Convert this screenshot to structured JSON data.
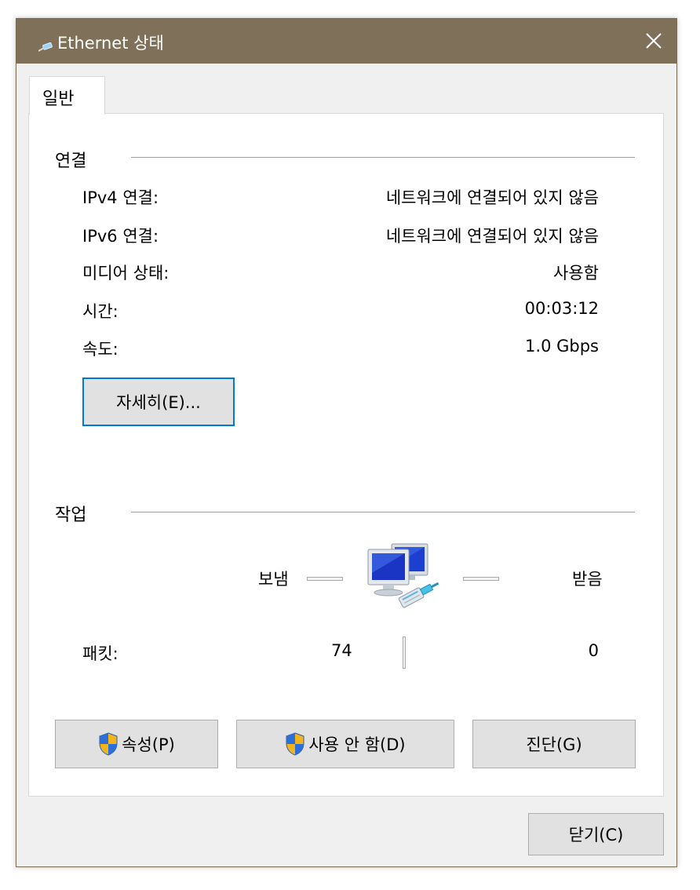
{
  "window": {
    "title": "Ethernet 상태",
    "icon": "network-cable-icon",
    "close": "close-icon"
  },
  "tabs": [
    {
      "label": "일반"
    }
  ],
  "connection": {
    "heading": "연결",
    "rows": [
      {
        "label": "IPv4 연결:",
        "value": "네트워크에 연결되어 있지 않음"
      },
      {
        "label": "IPv6 연결:",
        "value": "네트워크에 연결되어 있지 않음"
      },
      {
        "label": "미디어 상태:",
        "value": "사용함"
      },
      {
        "label": "시간:",
        "value": "00:03:12"
      },
      {
        "label": "속도:",
        "value": "1.0 Gbps"
      }
    ],
    "details_button": "자세히(E)..."
  },
  "activity": {
    "heading": "작업",
    "sent_label": "보냄",
    "received_label": "받음",
    "packets_label": "패킷:",
    "packets_sent": "74",
    "packets_received": "0",
    "icon": "network-computers-icon"
  },
  "actions": {
    "properties": "속성(P)",
    "disable": "사용 안 함(D)",
    "diagnose": "진단(G)",
    "close": "닫기(C)"
  },
  "colors": {
    "titlebar": "#7f7159",
    "focus_border": "#0078d7",
    "button_face": "#e1e1e1",
    "dialog_bg": "#f0f0f0"
  }
}
